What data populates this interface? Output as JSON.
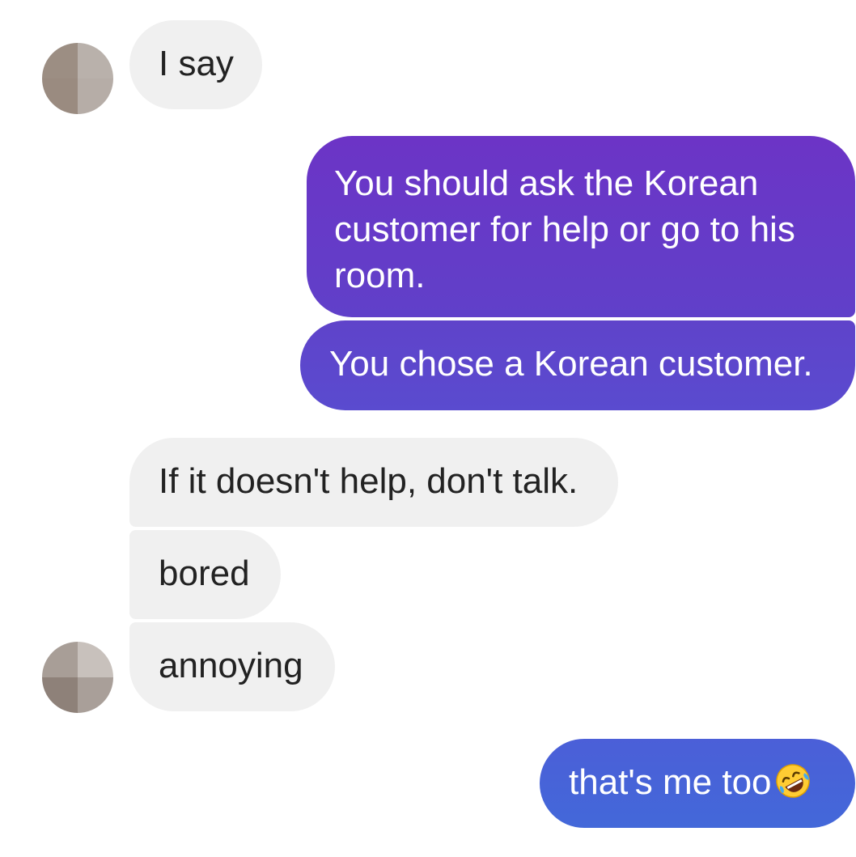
{
  "conversation": {
    "messages": [
      {
        "sender": "contact",
        "text": "I say"
      },
      {
        "sender": "me",
        "text": "You should ask the Korean customer for help or go to his room."
      },
      {
        "sender": "me",
        "text": "You chose a Korean customer."
      },
      {
        "sender": "contact",
        "text": "If it doesn't help, don't talk."
      },
      {
        "sender": "contact",
        "text": "bored"
      },
      {
        "sender": "contact",
        "text": "annoying"
      },
      {
        "sender": "me",
        "text": "that's me too",
        "emoji": "rolling-on-the-floor-laughing"
      }
    ]
  },
  "colors": {
    "incoming_bubble": "#f0f0f0",
    "incoming_text": "#222222",
    "outgoing_text": "#ffffff",
    "outgoing_gradient_top": "#6c34c6",
    "outgoing_gradient_mid": "#5a45cc",
    "outgoing_gradient_bottom": "#4a63d8",
    "avatar_blur_tones": [
      "#9c8e83",
      "#b9b1ab",
      "#a89e97",
      "#c8c1bc"
    ]
  }
}
